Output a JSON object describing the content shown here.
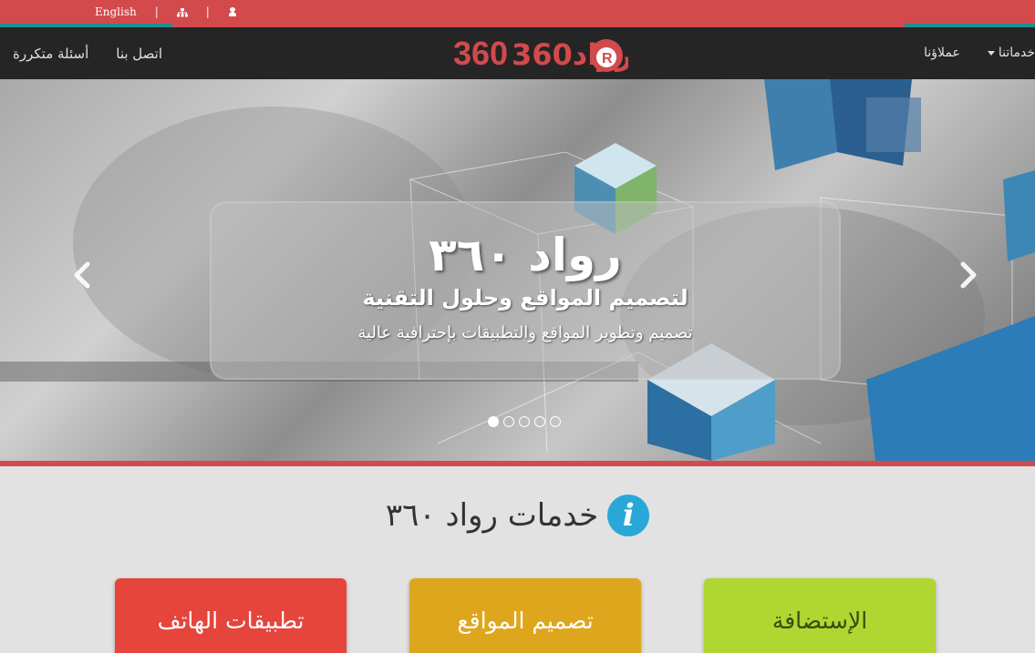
{
  "topbar": {
    "language_label": "English",
    "separator": "|",
    "icons": [
      "sitemap-icon",
      "user-icon"
    ],
    "color": "#d24a4c",
    "accent_color": "#1d8f8f"
  },
  "navbar": {
    "left_items": [
      "اتصل بنا",
      "أسئلة متكررة"
    ],
    "right_items": [
      "خدماتنا",
      "عملاؤنا"
    ],
    "logo_text": "رواد360",
    "logo_letter": "R"
  },
  "hero": {
    "title": "رواد ٣٦٠",
    "subtitle": "لتصميم المواقع وحلول التقنية",
    "tagline": "تصميم وتطوير المواقع والتطبيقات بإحترافية عالية",
    "slide_count": 5,
    "active_slide": 1
  },
  "services": {
    "heading": "خدمات رواد ٣٦٠",
    "info_glyph": "i",
    "cards": [
      {
        "label": "تطبيقات الهاتف",
        "color": "#e5453b"
      },
      {
        "label": "تصميم المواقع",
        "color": "#dea61d"
      },
      {
        "label": "الإستضافة",
        "color": "#b0d631"
      }
    ]
  }
}
